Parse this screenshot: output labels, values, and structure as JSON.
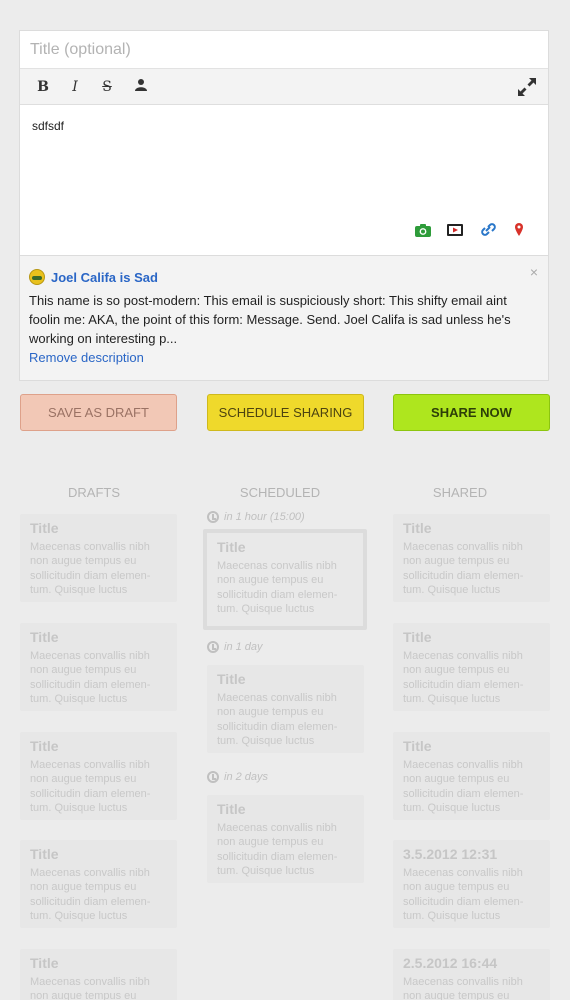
{
  "composer": {
    "title_placeholder": "Title (optional)",
    "toolbar": {
      "bold": "B",
      "italic": "I",
      "strike": "S"
    },
    "body_text": "sdfsdf",
    "attach_icons": [
      "camera-icon",
      "video-icon",
      "link-icon",
      "location-pin-icon"
    ]
  },
  "preview": {
    "title": "Joel Califa is Sad",
    "close": "×",
    "description": "This name is so post-modern: This email is suspiciously short: This shifty email aint foolin me: AKA, the point of this form: Message. Send. Joel Califa is sad unless he's working on interesting p...",
    "remove_link": "Remove description"
  },
  "buttons": {
    "draft": "SAVE AS DRAFT",
    "schedule": "SCHEDULE SHARING",
    "share": "SHARE NOW"
  },
  "columns": {
    "drafts": {
      "heading": "DRAFTS",
      "cards": [
        {
          "title": "Title",
          "body": "Maecenas convallis nibh non augue tempus eu sollicitudin diam elemen-tum. Quisque luctus"
        },
        {
          "title": "Title",
          "body": "Maecenas convallis nibh non augue tempus eu sollicitudin diam elemen-tum. Quisque luctus"
        },
        {
          "title": "Title",
          "body": "Maecenas convallis nibh non augue tempus eu sollicitudin diam elemen-tum. Quisque luctus"
        },
        {
          "title": "Title",
          "body": "Maecenas convallis nibh non augue tempus eu sollicitudin diam elemen-tum. Quisque luctus"
        },
        {
          "title": "Title",
          "body": "Maecenas convallis nibh non augue tempus eu"
        }
      ]
    },
    "scheduled": {
      "heading": "SCHEDULED",
      "groups": [
        {
          "label": "in 1 hour (15:00)",
          "title": "Title",
          "body": "Maecenas convallis nibh non augue tempus eu sollicitudin diam elemen-tum. Quisque luctus"
        },
        {
          "label": "in 1 day",
          "title": "Title",
          "body": "Maecenas convallis nibh non augue tempus eu sollicitudin diam elemen-tum. Quisque luctus"
        },
        {
          "label": "in 2 days",
          "title": "Title",
          "body": "Maecenas convallis nibh non augue tempus eu sollicitudin diam elemen-tum. Quisque luctus"
        }
      ]
    },
    "shared": {
      "heading": "SHARED",
      "cards": [
        {
          "title": "Title",
          "body": "Maecenas convallis nibh non augue tempus eu sollicitudin diam elemen-tum. Quisque luctus"
        },
        {
          "title": "Title",
          "body": "Maecenas convallis nibh non augue tempus eu sollicitudin diam elemen-tum. Quisque luctus"
        },
        {
          "title": "Title",
          "body": "Maecenas convallis nibh non augue tempus eu sollicitudin diam elemen-tum. Quisque luctus"
        },
        {
          "title": "3.5.2012 12:31",
          "body": "Maecenas convallis nibh non augue tempus eu sollicitudin diam elemen-tum. Quisque luctus"
        },
        {
          "title": "2.5.2012 16:44",
          "body": "Maecenas convallis nibh non augue tempus eu"
        }
      ]
    }
  },
  "colors": {
    "link": "#2a66c6",
    "draft_button": "#f2c8b6",
    "schedule_button": "#efd92b",
    "share_button": "#aee61e"
  }
}
